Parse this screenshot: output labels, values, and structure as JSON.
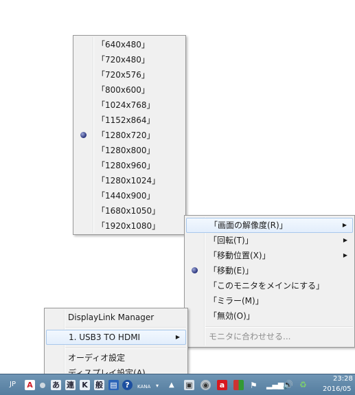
{
  "resolution_menu": {
    "items": [
      {
        "label": "「640x480」",
        "selected": false
      },
      {
        "label": "「720x480」",
        "selected": false
      },
      {
        "label": "「720x576」",
        "selected": false
      },
      {
        "label": "「800x600」",
        "selected": false
      },
      {
        "label": "「1024x768」",
        "selected": false
      },
      {
        "label": "「1152x864」",
        "selected": false
      },
      {
        "label": "「1280x720」",
        "selected": true
      },
      {
        "label": "「1280x800」",
        "selected": false
      },
      {
        "label": "「1280x960」",
        "selected": false
      },
      {
        "label": "「1280x1024」",
        "selected": false
      },
      {
        "label": "「1440x900」",
        "selected": false
      },
      {
        "label": "「1680x1050」",
        "selected": false
      },
      {
        "label": "「1920x1080」",
        "selected": false
      }
    ]
  },
  "display_menu": {
    "items": [
      {
        "label": "「画面の解像度(R)」",
        "has_submenu": true
      },
      {
        "label": "「回転(T)」",
        "has_submenu": true
      },
      {
        "label": "「移動位置(X)」",
        "has_submenu": true
      },
      {
        "label": "「移動(E)」",
        "has_submenu": false,
        "selected": true
      },
      {
        "label": "「このモニタをメインにする」",
        "has_submenu": false
      },
      {
        "label": "「ミラー(M)」",
        "has_submenu": false
      },
      {
        "label": "「無効(O)」",
        "has_submenu": false
      }
    ],
    "disabled_item": "モニタに合わせせる..."
  },
  "main_menu": {
    "title": "DisplayLink Manager",
    "device": "1. USB3 TO HDMI",
    "audio": "オーディオ設定",
    "display": "ディスプレイ設定(A)"
  },
  "taskbar": {
    "lang": "JP",
    "ime_mode": "あ",
    "ime_conv": "連",
    "ime_k": "K",
    "ime_han": "般",
    "kana": "KANA",
    "time": "23:28",
    "date": "2016/05",
    "icons": [
      "acrobat-icon",
      "ime-settings-icon",
      "help-icon",
      "network-icon",
      "displaylink-icon",
      "avira-icon",
      "flag-icon",
      "signal-icon",
      "volume-icon",
      "recycle-icon"
    ]
  }
}
